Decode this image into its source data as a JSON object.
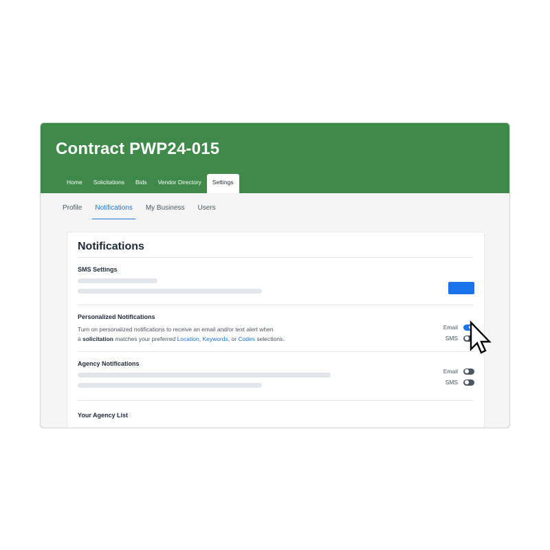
{
  "header": {
    "title": "Contract PWP24-015",
    "nav": [
      "Home",
      "Solicitations",
      "Bids",
      "Vendor Directory",
      "Settings"
    ],
    "active_nav": "Settings"
  },
  "subtabs": {
    "items": [
      "Profile",
      "Notifications",
      "My Business",
      "Users"
    ],
    "active": "Notifications"
  },
  "card": {
    "title": "Notifications",
    "sms": {
      "title": "SMS Settings"
    },
    "personalized": {
      "title": "Personalized Notifications",
      "line1": "Turn on personalized notifications to receive an email and/or text alert when",
      "line2_prefix": "a ",
      "line2_bold": "solicitation",
      "line2_mid": " matches your preferred ",
      "link_location": "Location",
      "sep1": ", ",
      "link_keywords": "Keywords",
      "sep2": ", or ",
      "link_codes": "Codes",
      "line2_suffix": " selections.",
      "email_label": "Email",
      "sms_label": "SMS",
      "email_on": true,
      "sms_on": false
    },
    "agency": {
      "title": "Agency Notifications",
      "email_label": "Email",
      "sms_label": "SMS",
      "email_on": false,
      "sms_on": false
    },
    "agency_list": {
      "title": "Your Agency List"
    }
  },
  "colors": {
    "header_green": "#3f8a4b",
    "accent_blue": "#1a73e8",
    "link_blue": "#1a73d9"
  },
  "icons": {
    "cursor": "pointer-arrow-icon"
  }
}
